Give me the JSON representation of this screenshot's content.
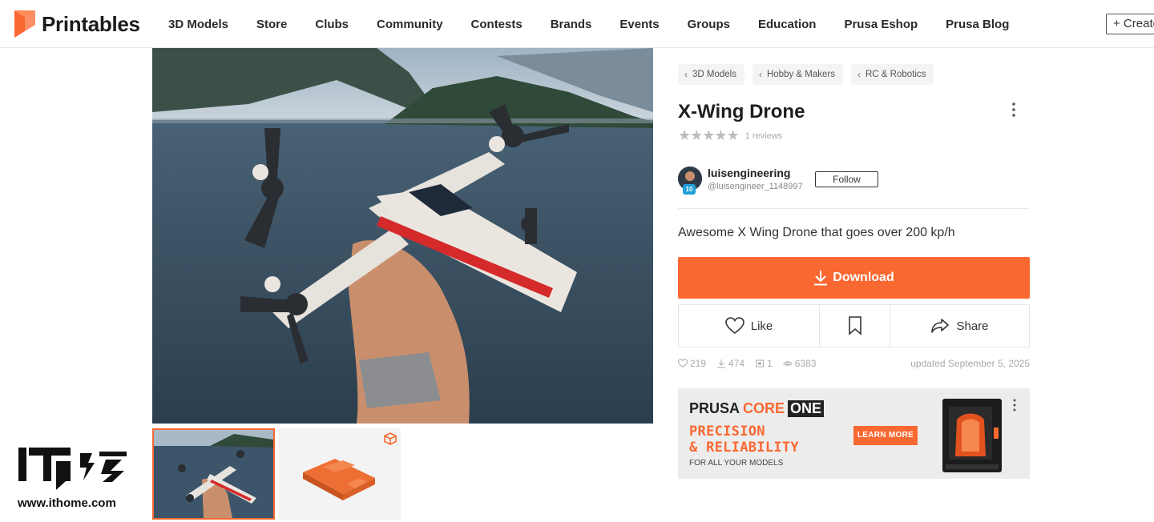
{
  "brand": {
    "name": "Printables",
    "accent": "#fa6831"
  },
  "nav": {
    "items": [
      "3D Models",
      "Store",
      "Clubs",
      "Community",
      "Contests",
      "Brands",
      "Events",
      "Groups",
      "Education",
      "Prusa Eshop",
      "Prusa Blog"
    ],
    "create_label": "+ Create"
  },
  "breadcrumbs": [
    "3D Models",
    "Hobby & Makers",
    "RC & Robotics"
  ],
  "model": {
    "title": "X-Wing Drone",
    "rating_stars": "★★★★★",
    "reviews": "1 reviews",
    "summary": "Awesome X Wing Drone that goes over 200 kp/h"
  },
  "author": {
    "name": "luisengineering",
    "handle": "@luisengineer_1148997",
    "level": "10",
    "follow_label": "Follow"
  },
  "actions": {
    "download_label": "Download",
    "like_label": "Like",
    "share_label": "Share"
  },
  "stats": {
    "likes": "219",
    "downloads": "474",
    "makes": "1",
    "views": "6383",
    "updated": "updated September 5, 2025"
  },
  "ad": {
    "prusa": "PRUSA",
    "core": "CORE",
    "one": "ONE",
    "tagline_1": "PRECISION",
    "tagline_2": "& RELIABILITY",
    "tagline_3": "FOR ALL YOUR MODELS",
    "cta": "LEARN MORE"
  },
  "watermark": {
    "url": "www.ithome.com"
  },
  "icons": {
    "logo": "printables-logo-icon",
    "chevron": "chevron-left-icon",
    "more": "more-vertical-icon",
    "download": "download-icon",
    "like": "heart-icon",
    "bookmark": "bookmark-icon",
    "share": "share-icon",
    "model3d": "cube-icon"
  }
}
